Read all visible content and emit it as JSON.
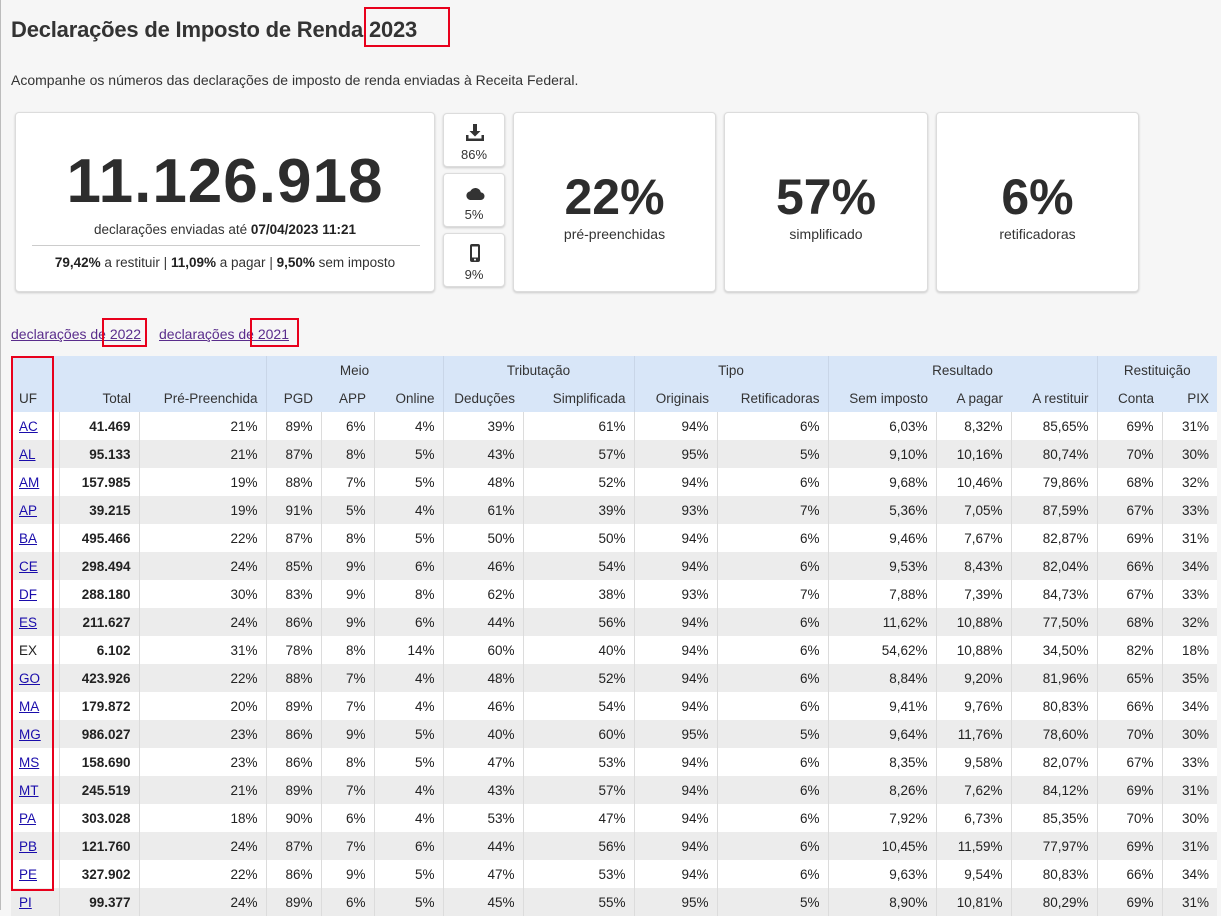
{
  "header": {
    "title": "Declarações de Imposto de Renda 2023",
    "subtitle": "Acompanhe os números das declarações de imposto de renda enviadas à Receita Federal."
  },
  "summary": {
    "total": "11.126.918",
    "sent_label": "declarações enviadas até",
    "sent_datetime": "07/04/2023 11:21",
    "restituir_pct": "79,42%",
    "restituir_label": "a restituir",
    "pagar_pct": "11,09%",
    "pagar_label": "a pagar",
    "sem_imposto_pct": "9,50%",
    "sem_imposto_label": "sem imposto",
    "separator": "|"
  },
  "channels": [
    {
      "icon": "download-icon",
      "value": "86%"
    },
    {
      "icon": "cloud-icon",
      "value": "5%"
    },
    {
      "icon": "mobile-phone-icon",
      "value": "9%"
    }
  ],
  "stats": [
    {
      "value": "22%",
      "label": "pré-preenchidas"
    },
    {
      "value": "57%",
      "label": "simplificado"
    },
    {
      "value": "6%",
      "label": "retificadoras"
    }
  ],
  "links": [
    {
      "label": "declarações de 2022"
    },
    {
      "label": "declarações de 2021"
    }
  ],
  "table": {
    "groups": [
      "Meio",
      "Tributação",
      "Tipo",
      "Resultado",
      "Restituição"
    ],
    "columns": [
      "UF",
      "Total",
      "Pré-Preenchida",
      "PGD",
      "APP",
      "Online",
      "Deduções",
      "Simplificada",
      "Originais",
      "Retificadoras",
      "Sem imposto",
      "A pagar",
      "A restituir",
      "Conta",
      "PIX"
    ],
    "rows": [
      {
        "uf": "AC",
        "link": true,
        "cells": [
          "41.469",
          "21%",
          "89%",
          "6%",
          "4%",
          "39%",
          "61%",
          "94%",
          "6%",
          "6,03%",
          "8,32%",
          "85,65%",
          "69%",
          "31%"
        ]
      },
      {
        "uf": "AL",
        "link": true,
        "cells": [
          "95.133",
          "21%",
          "87%",
          "8%",
          "5%",
          "43%",
          "57%",
          "95%",
          "5%",
          "9,10%",
          "10,16%",
          "80,74%",
          "70%",
          "30%"
        ]
      },
      {
        "uf": "AM",
        "link": true,
        "cells": [
          "157.985",
          "19%",
          "88%",
          "7%",
          "5%",
          "48%",
          "52%",
          "94%",
          "6%",
          "9,68%",
          "10,46%",
          "79,86%",
          "68%",
          "32%"
        ]
      },
      {
        "uf": "AP",
        "link": true,
        "cells": [
          "39.215",
          "19%",
          "91%",
          "5%",
          "4%",
          "61%",
          "39%",
          "93%",
          "7%",
          "5,36%",
          "7,05%",
          "87,59%",
          "67%",
          "33%"
        ]
      },
      {
        "uf": "BA",
        "link": true,
        "cells": [
          "495.466",
          "22%",
          "87%",
          "8%",
          "5%",
          "50%",
          "50%",
          "94%",
          "6%",
          "9,46%",
          "7,67%",
          "82,87%",
          "69%",
          "31%"
        ]
      },
      {
        "uf": "CE",
        "link": true,
        "cells": [
          "298.494",
          "24%",
          "85%",
          "9%",
          "6%",
          "46%",
          "54%",
          "94%",
          "6%",
          "9,53%",
          "8,43%",
          "82,04%",
          "66%",
          "34%"
        ]
      },
      {
        "uf": "DF",
        "link": true,
        "cells": [
          "288.180",
          "30%",
          "83%",
          "9%",
          "8%",
          "62%",
          "38%",
          "93%",
          "7%",
          "7,88%",
          "7,39%",
          "84,73%",
          "67%",
          "33%"
        ]
      },
      {
        "uf": "ES",
        "link": true,
        "cells": [
          "211.627",
          "24%",
          "86%",
          "9%",
          "6%",
          "44%",
          "56%",
          "94%",
          "6%",
          "11,62%",
          "10,88%",
          "77,50%",
          "68%",
          "32%"
        ]
      },
      {
        "uf": "EX",
        "link": false,
        "cells": [
          "6.102",
          "31%",
          "78%",
          "8%",
          "14%",
          "60%",
          "40%",
          "94%",
          "6%",
          "54,62%",
          "10,88%",
          "34,50%",
          "82%",
          "18%"
        ]
      },
      {
        "uf": "GO",
        "link": true,
        "cells": [
          "423.926",
          "22%",
          "88%",
          "7%",
          "4%",
          "48%",
          "52%",
          "94%",
          "6%",
          "8,84%",
          "9,20%",
          "81,96%",
          "65%",
          "35%"
        ]
      },
      {
        "uf": "MA",
        "link": true,
        "cells": [
          "179.872",
          "20%",
          "89%",
          "7%",
          "4%",
          "46%",
          "54%",
          "94%",
          "6%",
          "9,41%",
          "9,76%",
          "80,83%",
          "66%",
          "34%"
        ]
      },
      {
        "uf": "MG",
        "link": true,
        "cells": [
          "986.027",
          "23%",
          "86%",
          "9%",
          "5%",
          "40%",
          "60%",
          "95%",
          "5%",
          "9,64%",
          "11,76%",
          "78,60%",
          "70%",
          "30%"
        ]
      },
      {
        "uf": "MS",
        "link": true,
        "cells": [
          "158.690",
          "23%",
          "86%",
          "8%",
          "5%",
          "47%",
          "53%",
          "94%",
          "6%",
          "8,35%",
          "9,58%",
          "82,07%",
          "67%",
          "33%"
        ]
      },
      {
        "uf": "MT",
        "link": true,
        "cells": [
          "245.519",
          "21%",
          "89%",
          "7%",
          "4%",
          "43%",
          "57%",
          "94%",
          "6%",
          "8,26%",
          "7,62%",
          "84,12%",
          "69%",
          "31%"
        ]
      },
      {
        "uf": "PA",
        "link": true,
        "cells": [
          "303.028",
          "18%",
          "90%",
          "6%",
          "4%",
          "53%",
          "47%",
          "94%",
          "6%",
          "7,92%",
          "6,73%",
          "85,35%",
          "70%",
          "30%"
        ]
      },
      {
        "uf": "PB",
        "link": true,
        "cells": [
          "121.760",
          "24%",
          "87%",
          "7%",
          "6%",
          "44%",
          "56%",
          "94%",
          "6%",
          "10,45%",
          "11,59%",
          "77,97%",
          "69%",
          "31%"
        ]
      },
      {
        "uf": "PE",
        "link": true,
        "cells": [
          "327.902",
          "22%",
          "86%",
          "9%",
          "5%",
          "47%",
          "53%",
          "94%",
          "6%",
          "9,63%",
          "9,54%",
          "80,83%",
          "66%",
          "34%"
        ]
      },
      {
        "uf": "PI",
        "link": true,
        "cells": [
          "99.377",
          "24%",
          "89%",
          "6%",
          "5%",
          "45%",
          "55%",
          "95%",
          "5%",
          "8,90%",
          "10,81%",
          "80,29%",
          "69%",
          "31%"
        ]
      }
    ]
  }
}
